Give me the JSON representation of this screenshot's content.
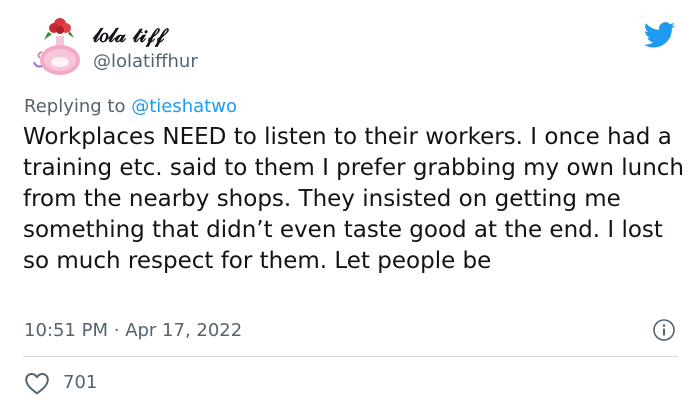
{
  "author": {
    "display_name": "𝓁𝑜𝓁𝒶 𝓉𝒾𝒻𝒻",
    "handle": "@lolatiffhur"
  },
  "reply": {
    "prefix": "Replying to",
    "mention": "@tieshatwo"
  },
  "tweet": {
    "text": "Workplaces NEED to listen to their workers. I once had a training etc. said to them I prefer grabbing my own lunch from the nearby shops. They insisted on getting me something that didn’t even taste good at the end. I lost so much respect for them. Let people be",
    "time": "10:51 PM",
    "separator": "·",
    "date": "Apr 17, 2022"
  },
  "stats": {
    "likes": "701"
  },
  "colors": {
    "brand": "#1d9bf0",
    "muted": "#536471",
    "text": "#0f1419",
    "divider": "#cfd9de"
  },
  "icons": {
    "logo": "twitter-bird-icon",
    "info": "info-icon",
    "like": "heart-icon",
    "avatar": "perfume-bottle-avatar"
  }
}
